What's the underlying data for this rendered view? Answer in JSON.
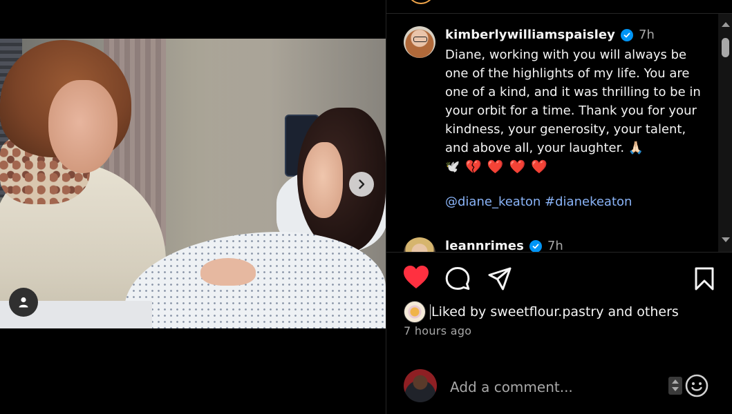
{
  "caption": {
    "username": "kimberlywilliamspaisley",
    "time": "7h",
    "text": "Diane, working with you will always be one of the highlights of my life. You are one of a kind, and it was thrilling to be in your orbit for a time. Thank you for your kindness, your generosity, your talent, and above all, your laughter. 🙏🏻",
    "emojis": [
      "🕊️",
      "💔",
      "❤️",
      "❤️",
      "❤️"
    ],
    "mention": "@diane_keaton",
    "hashtag": "#dianekeaton"
  },
  "reply": {
    "username": "leannrimes",
    "time": "7h"
  },
  "likes": {
    "prefix": "Liked by ",
    "user": "sweetflour.pastry",
    "suffix": " and others"
  },
  "post_time": "7 hours ago",
  "comment_box": {
    "placeholder": "Add a comment..."
  },
  "icons": {
    "like": "heart-filled-icon",
    "comment": "speech-bubble-icon",
    "share": "paper-plane-icon",
    "save": "bookmark-icon",
    "next": "chevron-right-icon",
    "tag": "user-icon",
    "emoji": "smiley-icon"
  },
  "colors": {
    "like_red": "#ff3040",
    "link_blue": "#8ab4f8",
    "verified_blue": "#0095f6",
    "muted_text": "#a8a8a8"
  }
}
